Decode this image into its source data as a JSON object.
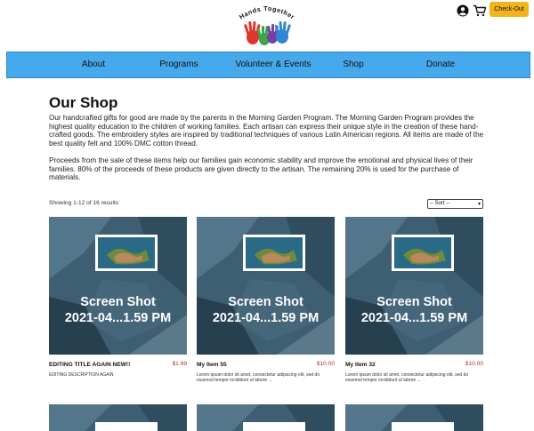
{
  "header": {
    "logo_text": "Hands Together",
    "checkout_label": "Check-Out",
    "account_icon": "account-circle-icon",
    "cart_icon": "shopping-cart-icon"
  },
  "nav": {
    "items": [
      {
        "label": "About"
      },
      {
        "label": "Programs"
      },
      {
        "label": "Volunteer & Events"
      },
      {
        "label": "Shop"
      },
      {
        "label": "Donate"
      }
    ],
    "bg_color": "#46a9eb"
  },
  "main": {
    "title": "Our Shop",
    "paragraph1": "Our handcrafted gifts for good are made by the parents in the Morning Garden Program. The Morning Garden Program provides the highest quality education to the children of working families. Each artisan can express their unique style in the creation of these hand-crafted goods. The embroidery styles are inspired by traditional techniques of various Latin American regions. All items are made of the best quality felt and 100% DMC cotton thread.",
    "paragraph2": "Proceeds from the sale of these items help our families gain economic stability and improve the emotional and physical lives of their families. 80% of the proceeds of these products are given directly to the artisan. The remaining 20% is used for the purchase of materials.",
    "showing_text": "Showing 1-12 of 16 results",
    "sort_selected": "-- Sort --"
  },
  "products": [
    {
      "caption_line1": "Screen Shot",
      "caption_line2": "2021-04...1.59 PM",
      "title": "EDITING TITLE AGAIN NEW!!",
      "price": "$1.99",
      "description": "EDITING DESCRIPTION AGAIN"
    },
    {
      "caption_line1": "Screen Shot",
      "caption_line2": "2021-04...1.59 PM",
      "title": "My Item 55",
      "price": "$10.00",
      "description": "Lorem ipsum dolor sit amet, consectetur adipiscing elit, sed do eiusmod tempor incididunt ut labore ..."
    },
    {
      "caption_line1": "Screen Shot",
      "caption_line2": "2021-04...1.59 PM",
      "title": "My Item 32",
      "price": "$10.00",
      "description": "Lorem ipsum dolor sit amet, consectetur adipiscing elit, sed do eiusmod tempor incididunt ut labore ..."
    }
  ],
  "colors": {
    "accent": "#f2b31b",
    "price": "#b0322a"
  }
}
